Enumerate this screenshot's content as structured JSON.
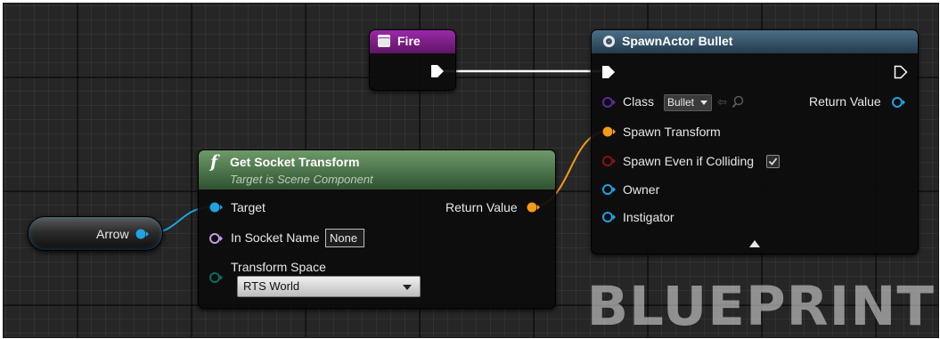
{
  "nodes": {
    "fire": {
      "title": "Fire",
      "header_color": "#7a1f86"
    },
    "spawn_actor": {
      "title": "SpawnActor Bullet",
      "header_color": "#35546b",
      "class_label": "Class",
      "class_value": "Bullet",
      "return_value_label": "Return Value",
      "spawn_transform_label": "Spawn Transform",
      "spawn_colliding_label": "Spawn Even if Colliding",
      "spawn_colliding_checked": true,
      "owner_label": "Owner",
      "instigator_label": "Instigator"
    },
    "get_socket_transform": {
      "function_symbol": "f",
      "title": "Get Socket Transform",
      "subtitle": "Target is Scene Component",
      "header_color": "#3e6b3b",
      "target_label": "Target",
      "return_value_label": "Return Value",
      "socket_name_label": "In Socket Name",
      "socket_name_value": "None",
      "transform_space_label": "Transform Space",
      "transform_space_value": "RTS World"
    },
    "arrow": {
      "label": "Arrow"
    }
  },
  "pin_colors": {
    "exec": "#ffffff",
    "class": "#5b2a9e",
    "transform": "#f39a1a",
    "boolean": "#8a1212",
    "object": "#20a3e0",
    "name": "#c79be8",
    "enum": "#0c6c5f"
  },
  "watermark": "BLUEPRINT"
}
